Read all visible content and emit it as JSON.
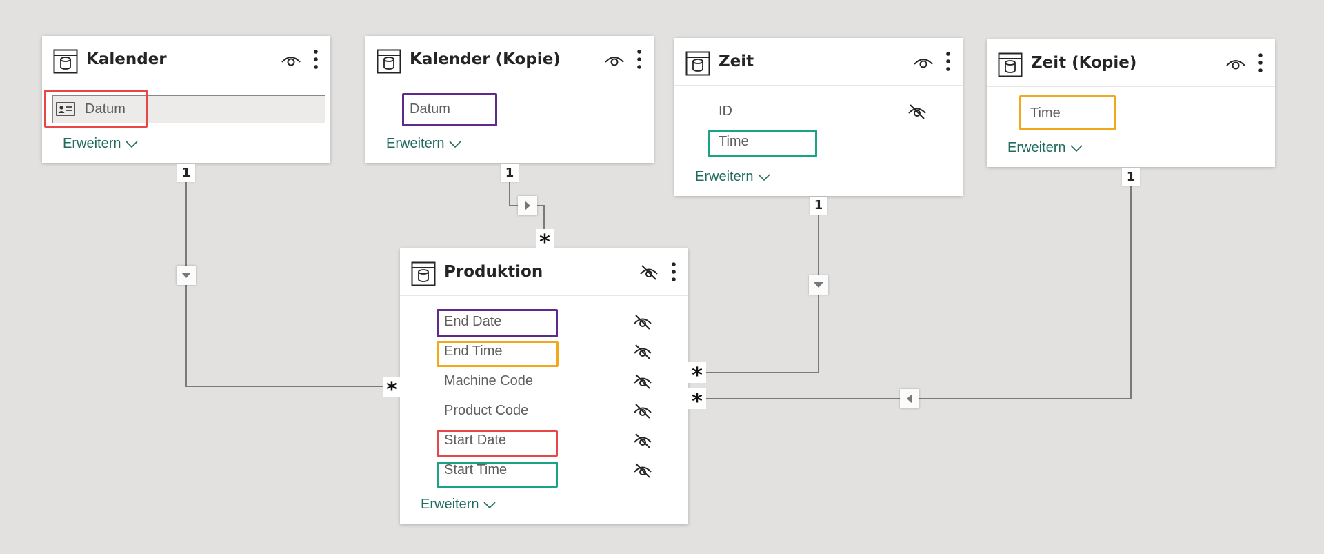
{
  "tables": {
    "kalender": {
      "name": "Kalender",
      "fields": [
        "Datum"
      ],
      "expand": "Erweitern"
    },
    "kalender_kopie": {
      "name": "Kalender (Kopie)",
      "fields": [
        "Datum"
      ],
      "expand": "Erweitern"
    },
    "zeit": {
      "name": "Zeit",
      "fields": [
        "ID",
        "Time"
      ],
      "expand": "Erweitern"
    },
    "zeit_kopie": {
      "name": "Zeit (Kopie)",
      "fields": [
        "Time"
      ],
      "expand": "Erweitern"
    },
    "produktion": {
      "name": "Produktion",
      "fields": [
        "End Date",
        "End Time",
        "Machine Code",
        "Product Code",
        "Start Date",
        "Start Time"
      ],
      "expand": "Erweitern"
    }
  },
  "relationships": [
    {
      "from": "Kalender.Datum",
      "to": "Produktion.Start Date",
      "one": "1",
      "many": "*",
      "direction": "down"
    },
    {
      "from": "Kalender (Kopie).Datum",
      "to": "Produktion.End Date",
      "one": "1",
      "many": "*",
      "direction": "right"
    },
    {
      "from": "Zeit.Time",
      "to": "Produktion.Start Time",
      "one": "1",
      "many": "*",
      "direction": "down"
    },
    {
      "from": "Zeit (Kopie).Time",
      "to": "Produktion.End Time",
      "one": "1",
      "many": "*",
      "direction": "left"
    }
  ],
  "colors": {
    "canvas": "#e2e1df",
    "link": "#1f6b5e",
    "connector": "#7a7a7a",
    "highlight_red": "#e8474a",
    "highlight_purple": "#5e2a8c",
    "highlight_orange": "#f2a81d",
    "highlight_teal": "#1aa384"
  },
  "icons": {
    "table": "table-icon",
    "visible": "eye-icon",
    "hidden": "eye-slash-icon",
    "more": "more-vertical-icon",
    "expand": "chevron-down-icon",
    "field_type": "id-card-icon"
  }
}
